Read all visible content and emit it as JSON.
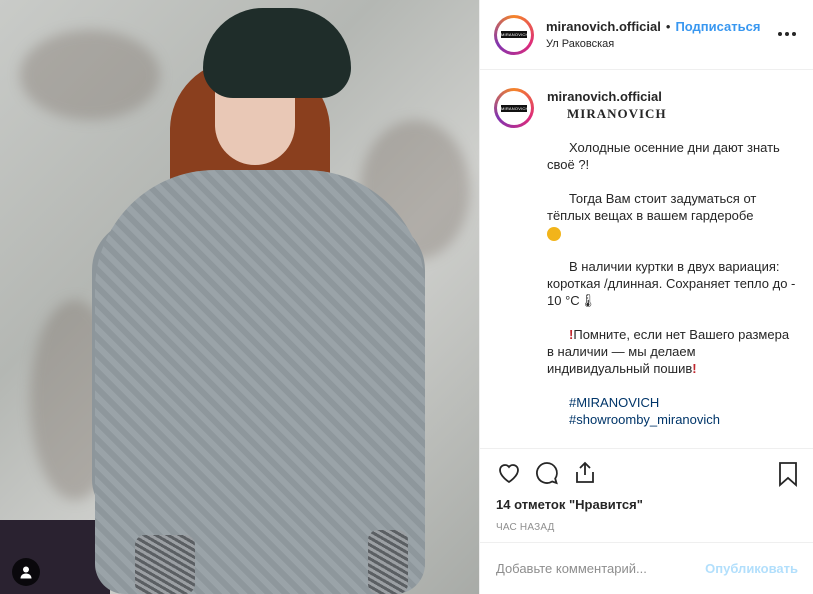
{
  "header": {
    "username": "miranovich.official",
    "separator": "•",
    "follow_label": "Подписаться",
    "location": "Ул Раковская",
    "more_icon": "more-horizontal-icon",
    "avatar_logo_text": "MIRANOVICH"
  },
  "caption": {
    "username": "miranovich.official",
    "brand": "MIRANOVICH",
    "paragraphs": [
      "Холодные осенние дни дают знать своё ?!",
      "Тогда Вам стоит задуматься от тёплых вещах в вашем гардеробе",
      "В наличии куртки в двух вариация: короткая /длинная. Сохраняет тепло до - 10 °С🌡",
      "Помните, если нет Вашего размера в наличии — мы делаем индивидуальный пошив"
    ],
    "hashtags": [
      "#MIRANOVICH",
      "#showroomby_miranovich"
    ]
  },
  "actions": {
    "like_icon": "heart-icon",
    "comment_icon": "comment-icon",
    "share_icon": "share-icon",
    "save_icon": "bookmark-icon",
    "likes_text": "14 отметок \"Нравится\"",
    "time_text": "ЧАС НАЗАД"
  },
  "comment": {
    "placeholder": "Добавьте комментарий...",
    "post_label": "Опубликовать"
  },
  "colors": {
    "link_blue": "#3897f0",
    "hashtag_blue": "#003569",
    "post_disabled": "#b2dffc",
    "muted": "#8e8e8e"
  }
}
